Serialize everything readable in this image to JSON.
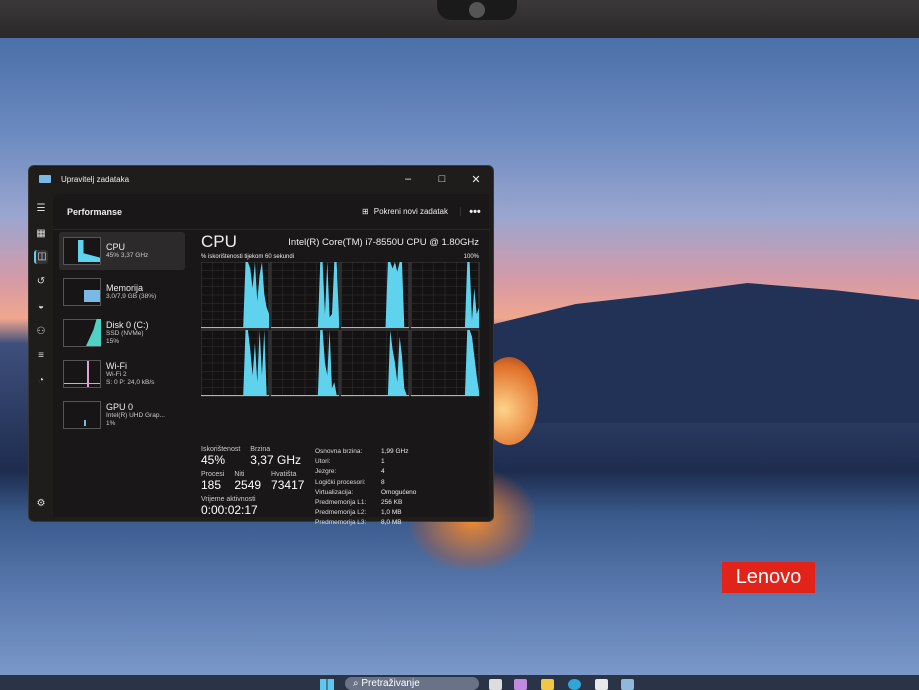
{
  "window": {
    "title": "Upravitelj zadataka",
    "page": "Performanse",
    "new_task": "Pokreni novi zadatak",
    "more": "•••"
  },
  "sidebar": [
    {
      "title": "CPU",
      "line1": "45% 3,37 GHz",
      "color": "#5fd3ee"
    },
    {
      "title": "Memorija",
      "line1": "3,0/7,9 GB (38%)",
      "color": "#7ab8e6"
    },
    {
      "title": "Disk 0 (C:)",
      "line1": "SSD (NVMe)",
      "line2": "15%",
      "color": "#4fd1c5"
    },
    {
      "title": "Wi-Fi",
      "line1": "Wi-Fi 2",
      "line2": "S: 0 P: 24,0 kB/s",
      "color": "#e6a0d8"
    },
    {
      "title": "GPU 0",
      "line1": "Intel(R) UHD Grap...",
      "line2": "1%",
      "color": "#7ab8e6"
    }
  ],
  "cpu": {
    "title": "CPU",
    "model": "Intel(R) Core(TM) i7-8550U CPU @ 1.80GHz",
    "graph_label": "% iskorištenosti tijekom 60 sekundi",
    "graph_max": "100%"
  },
  "stats": {
    "util_label": "Iskorištenost",
    "util": "45%",
    "speed_label": "Brzina",
    "speed": "3,37 GHz",
    "proc_label": "Procesi",
    "proc": "185",
    "threads_label": "Niti",
    "threads": "2549",
    "handles_label": "Hvatišta",
    "handles": "73417",
    "uptime_label": "Vrijeme aktivnosti",
    "uptime": "0:00:02:17"
  },
  "specs": [
    {
      "k": "Osnovna brzina:",
      "v": "1,99 GHz"
    },
    {
      "k": "Utori:",
      "v": "1"
    },
    {
      "k": "Jezgre:",
      "v": "4"
    },
    {
      "k": "Logički procesori:",
      "v": "8"
    },
    {
      "k": "Virtualizacija:",
      "v": "Omogućeno"
    },
    {
      "k": "Predmemorija L1:",
      "v": "256 KB"
    },
    {
      "k": "Predmemorija L2:",
      "v": "1,0 MB"
    },
    {
      "k": "Predmemorija L3:",
      "v": "8,0 MB"
    }
  ],
  "core_usage": [
    [
      0,
      0,
      0,
      0,
      0,
      0,
      0,
      0,
      0,
      0,
      0,
      0,
      0,
      0,
      0,
      0,
      0,
      0,
      0,
      100,
      100,
      90,
      60,
      100,
      40,
      80,
      100,
      50,
      30,
      20
    ],
    [
      0,
      0,
      0,
      0,
      0,
      0,
      0,
      0,
      0,
      0,
      0,
      0,
      0,
      0,
      0,
      0,
      0,
      0,
      0,
      0,
      0,
      100,
      100,
      20,
      100,
      15,
      20,
      100,
      100,
      10
    ],
    [
      0,
      0,
      0,
      0,
      0,
      0,
      0,
      0,
      0,
      0,
      0,
      0,
      0,
      0,
      0,
      0,
      0,
      0,
      0,
      0,
      100,
      100,
      90,
      100,
      85,
      100,
      100,
      0,
      0,
      0
    ],
    [
      0,
      0,
      0,
      0,
      0,
      0,
      0,
      0,
      0,
      0,
      0,
      0,
      0,
      0,
      0,
      0,
      0,
      0,
      0,
      0,
      0,
      0,
      0,
      0,
      100,
      100,
      10,
      60,
      20,
      30
    ],
    [
      0,
      0,
      0,
      0,
      0,
      0,
      0,
      0,
      0,
      0,
      0,
      0,
      0,
      0,
      0,
      0,
      0,
      0,
      0,
      100,
      100,
      70,
      30,
      80,
      20,
      100,
      30,
      100,
      0,
      0
    ],
    [
      0,
      0,
      0,
      0,
      0,
      0,
      0,
      0,
      0,
      0,
      0,
      0,
      0,
      0,
      0,
      0,
      0,
      0,
      0,
      0,
      0,
      100,
      100,
      50,
      30,
      100,
      10,
      20,
      0,
      0
    ],
    [
      0,
      0,
      0,
      0,
      0,
      0,
      0,
      0,
      0,
      0,
      0,
      0,
      0,
      0,
      0,
      0,
      0,
      0,
      0,
      0,
      0,
      100,
      70,
      50,
      20,
      90,
      60,
      10,
      0,
      0
    ],
    [
      0,
      0,
      0,
      0,
      0,
      0,
      0,
      0,
      0,
      0,
      0,
      0,
      0,
      0,
      0,
      0,
      0,
      0,
      0,
      0,
      0,
      0,
      0,
      0,
      100,
      100,
      90,
      60,
      30,
      5
    ]
  ],
  "taskbar": {
    "search": "Pretraživanje"
  },
  "brand": "Lenovo"
}
